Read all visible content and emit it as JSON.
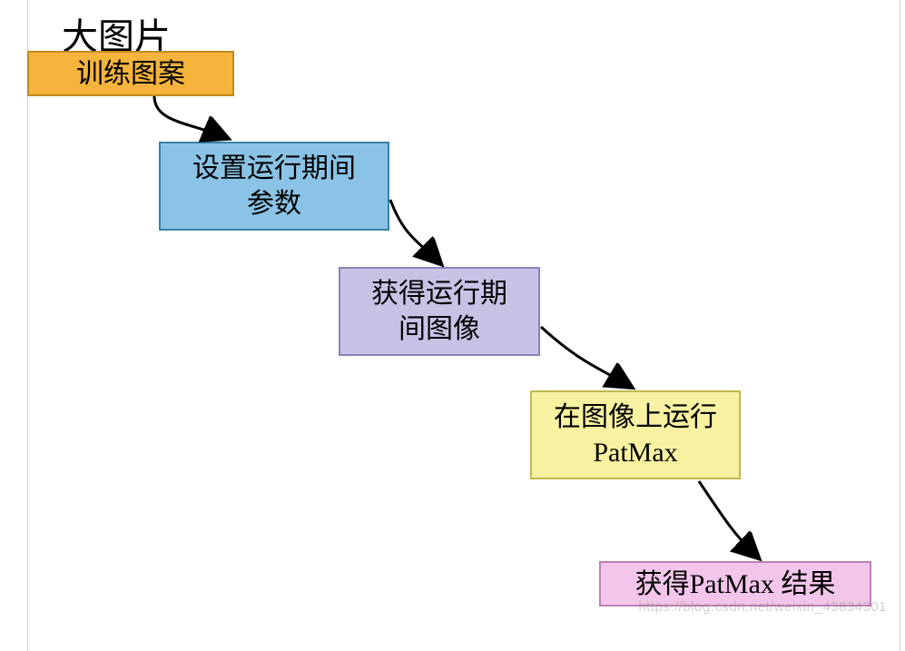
{
  "title": "大图片",
  "boxes": {
    "b1": "训练图案",
    "b2_line1": "设置运行期间",
    "b2_line2": "参数",
    "b3_line1": "获得运行期",
    "b3_line2": "间图像",
    "b4_line1": "在图像上运行",
    "b4_line2": "PatMax",
    "b5": "获得PatMax 结果"
  },
  "watermark": "https://blog.csdn.net/weixin_43834301"
}
